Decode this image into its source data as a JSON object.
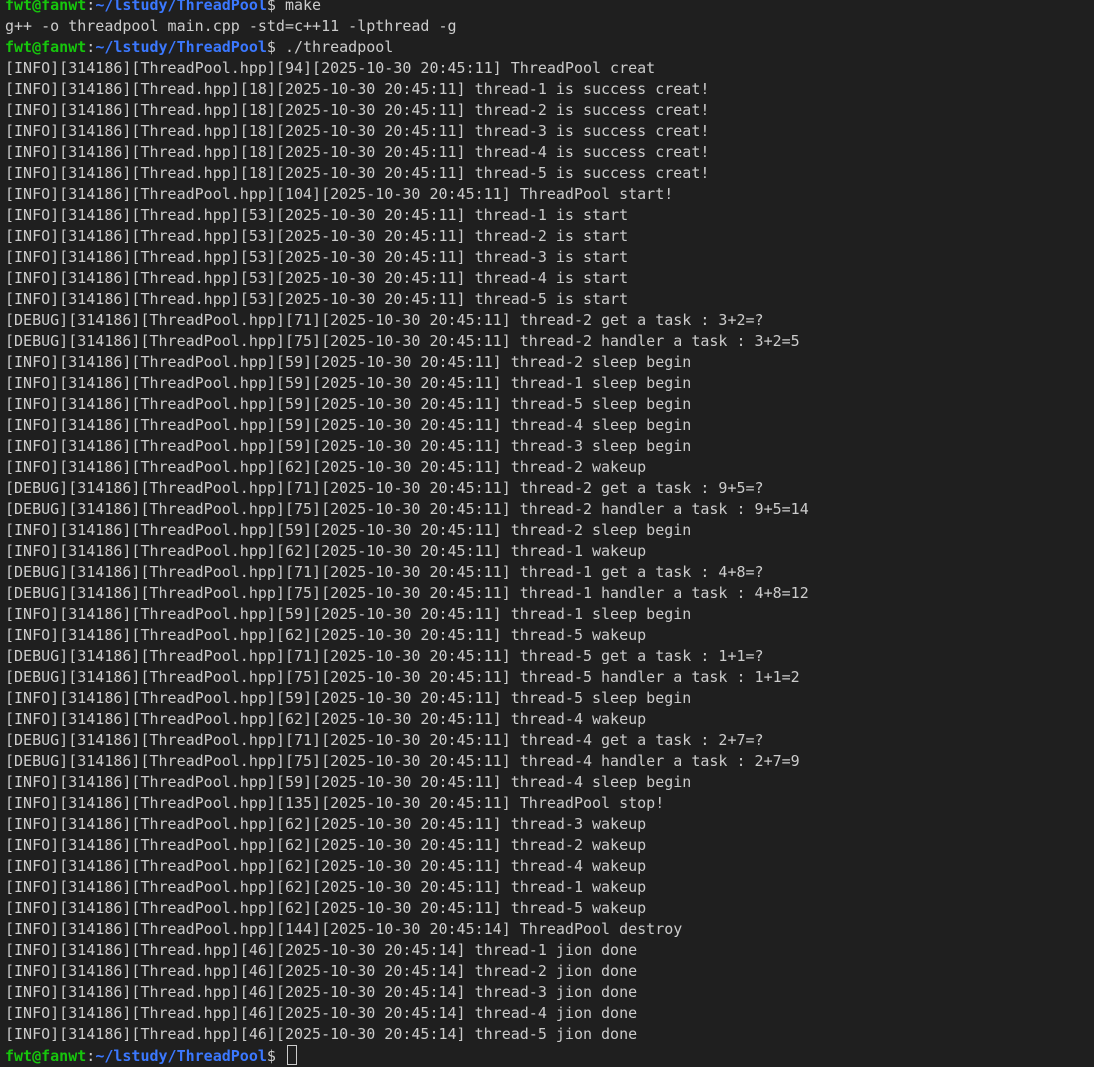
{
  "prompt": {
    "user_host": "fwt@fanwt",
    "sep": ":",
    "path": "~/lstudy/ThreadPool",
    "symbol": "$"
  },
  "colors": {
    "background": "#1f1f1f",
    "text": "#cccccc",
    "user_host": "#16c60c",
    "path": "#3b78ff"
  },
  "lines": [
    {
      "kind": "prompt",
      "cmd": " make"
    },
    {
      "kind": "out",
      "text": "g++ -o threadpool main.cpp -std=c++11 -lpthread -g"
    },
    {
      "kind": "prompt",
      "cmd": " ./threadpool"
    },
    {
      "kind": "out",
      "text": "[INFO][314186][ThreadPool.hpp][94][2025-10-30 20:45:11] ThreadPool creat"
    },
    {
      "kind": "out",
      "text": "[INFO][314186][Thread.hpp][18][2025-10-30 20:45:11] thread-1 is success creat!"
    },
    {
      "kind": "out",
      "text": "[INFO][314186][Thread.hpp][18][2025-10-30 20:45:11] thread-2 is success creat!"
    },
    {
      "kind": "out",
      "text": "[INFO][314186][Thread.hpp][18][2025-10-30 20:45:11] thread-3 is success creat!"
    },
    {
      "kind": "out",
      "text": "[INFO][314186][Thread.hpp][18][2025-10-30 20:45:11] thread-4 is success creat!"
    },
    {
      "kind": "out",
      "text": "[INFO][314186][Thread.hpp][18][2025-10-30 20:45:11] thread-5 is success creat!"
    },
    {
      "kind": "out",
      "text": "[INFO][314186][ThreadPool.hpp][104][2025-10-30 20:45:11] ThreadPool start!"
    },
    {
      "kind": "out",
      "text": "[INFO][314186][Thread.hpp][53][2025-10-30 20:45:11] thread-1 is start"
    },
    {
      "kind": "out",
      "text": "[INFO][314186][Thread.hpp][53][2025-10-30 20:45:11] thread-2 is start"
    },
    {
      "kind": "out",
      "text": "[INFO][314186][Thread.hpp][53][2025-10-30 20:45:11] thread-3 is start"
    },
    {
      "kind": "out",
      "text": "[INFO][314186][Thread.hpp][53][2025-10-30 20:45:11] thread-4 is start"
    },
    {
      "kind": "out",
      "text": "[INFO][314186][Thread.hpp][53][2025-10-30 20:45:11] thread-5 is start"
    },
    {
      "kind": "out",
      "text": "[DEBUG][314186][ThreadPool.hpp][71][2025-10-30 20:45:11] thread-2 get a task : 3+2=?"
    },
    {
      "kind": "out",
      "text": "[DEBUG][314186][ThreadPool.hpp][75][2025-10-30 20:45:11] thread-2 handler a task : 3+2=5"
    },
    {
      "kind": "out",
      "text": "[INFO][314186][ThreadPool.hpp][59][2025-10-30 20:45:11] thread-2 sleep begin"
    },
    {
      "kind": "out",
      "text": "[INFO][314186][ThreadPool.hpp][59][2025-10-30 20:45:11] thread-1 sleep begin"
    },
    {
      "kind": "out",
      "text": "[INFO][314186][ThreadPool.hpp][59][2025-10-30 20:45:11] thread-5 sleep begin"
    },
    {
      "kind": "out",
      "text": "[INFO][314186][ThreadPool.hpp][59][2025-10-30 20:45:11] thread-4 sleep begin"
    },
    {
      "kind": "out",
      "text": "[INFO][314186][ThreadPool.hpp][59][2025-10-30 20:45:11] thread-3 sleep begin"
    },
    {
      "kind": "out",
      "text": "[INFO][314186][ThreadPool.hpp][62][2025-10-30 20:45:11] thread-2 wakeup"
    },
    {
      "kind": "out",
      "text": "[DEBUG][314186][ThreadPool.hpp][71][2025-10-30 20:45:11] thread-2 get a task : 9+5=?"
    },
    {
      "kind": "out",
      "text": "[DEBUG][314186][ThreadPool.hpp][75][2025-10-30 20:45:11] thread-2 handler a task : 9+5=14"
    },
    {
      "kind": "out",
      "text": "[INFO][314186][ThreadPool.hpp][59][2025-10-30 20:45:11] thread-2 sleep begin"
    },
    {
      "kind": "out",
      "text": "[INFO][314186][ThreadPool.hpp][62][2025-10-30 20:45:11] thread-1 wakeup"
    },
    {
      "kind": "out",
      "text": "[DEBUG][314186][ThreadPool.hpp][71][2025-10-30 20:45:11] thread-1 get a task : 4+8=?"
    },
    {
      "kind": "out",
      "text": "[DEBUG][314186][ThreadPool.hpp][75][2025-10-30 20:45:11] thread-1 handler a task : 4+8=12"
    },
    {
      "kind": "out",
      "text": "[INFO][314186][ThreadPool.hpp][59][2025-10-30 20:45:11] thread-1 sleep begin"
    },
    {
      "kind": "out",
      "text": "[INFO][314186][ThreadPool.hpp][62][2025-10-30 20:45:11] thread-5 wakeup"
    },
    {
      "kind": "out",
      "text": "[DEBUG][314186][ThreadPool.hpp][71][2025-10-30 20:45:11] thread-5 get a task : 1+1=?"
    },
    {
      "kind": "out",
      "text": "[DEBUG][314186][ThreadPool.hpp][75][2025-10-30 20:45:11] thread-5 handler a task : 1+1=2"
    },
    {
      "kind": "out",
      "text": "[INFO][314186][ThreadPool.hpp][59][2025-10-30 20:45:11] thread-5 sleep begin"
    },
    {
      "kind": "out",
      "text": "[INFO][314186][ThreadPool.hpp][62][2025-10-30 20:45:11] thread-4 wakeup"
    },
    {
      "kind": "out",
      "text": "[DEBUG][314186][ThreadPool.hpp][71][2025-10-30 20:45:11] thread-4 get a task : 2+7=?"
    },
    {
      "kind": "out",
      "text": "[DEBUG][314186][ThreadPool.hpp][75][2025-10-30 20:45:11] thread-4 handler a task : 2+7=9"
    },
    {
      "kind": "out",
      "text": "[INFO][314186][ThreadPool.hpp][59][2025-10-30 20:45:11] thread-4 sleep begin"
    },
    {
      "kind": "out",
      "text": "[INFO][314186][ThreadPool.hpp][135][2025-10-30 20:45:11] ThreadPool stop!"
    },
    {
      "kind": "out",
      "text": "[INFO][314186][ThreadPool.hpp][62][2025-10-30 20:45:11] thread-3 wakeup"
    },
    {
      "kind": "out",
      "text": "[INFO][314186][ThreadPool.hpp][62][2025-10-30 20:45:11] thread-2 wakeup"
    },
    {
      "kind": "out",
      "text": "[INFO][314186][ThreadPool.hpp][62][2025-10-30 20:45:11] thread-4 wakeup"
    },
    {
      "kind": "out",
      "text": "[INFO][314186][ThreadPool.hpp][62][2025-10-30 20:45:11] thread-1 wakeup"
    },
    {
      "kind": "out",
      "text": "[INFO][314186][ThreadPool.hpp][62][2025-10-30 20:45:11] thread-5 wakeup"
    },
    {
      "kind": "out",
      "text": "[INFO][314186][ThreadPool.hpp][144][2025-10-30 20:45:14] ThreadPool destroy"
    },
    {
      "kind": "out",
      "text": "[INFO][314186][Thread.hpp][46][2025-10-30 20:45:14] thread-1 jion done"
    },
    {
      "kind": "out",
      "text": "[INFO][314186][Thread.hpp][46][2025-10-30 20:45:14] thread-2 jion done"
    },
    {
      "kind": "out",
      "text": "[INFO][314186][Thread.hpp][46][2025-10-30 20:45:14] thread-3 jion done"
    },
    {
      "kind": "out",
      "text": "[INFO][314186][Thread.hpp][46][2025-10-30 20:45:14] thread-4 jion done"
    },
    {
      "kind": "out",
      "text": "[INFO][314186][Thread.hpp][46][2025-10-30 20:45:14] thread-5 jion done"
    },
    {
      "kind": "prompt",
      "cmd": " ",
      "cursor": true
    }
  ]
}
